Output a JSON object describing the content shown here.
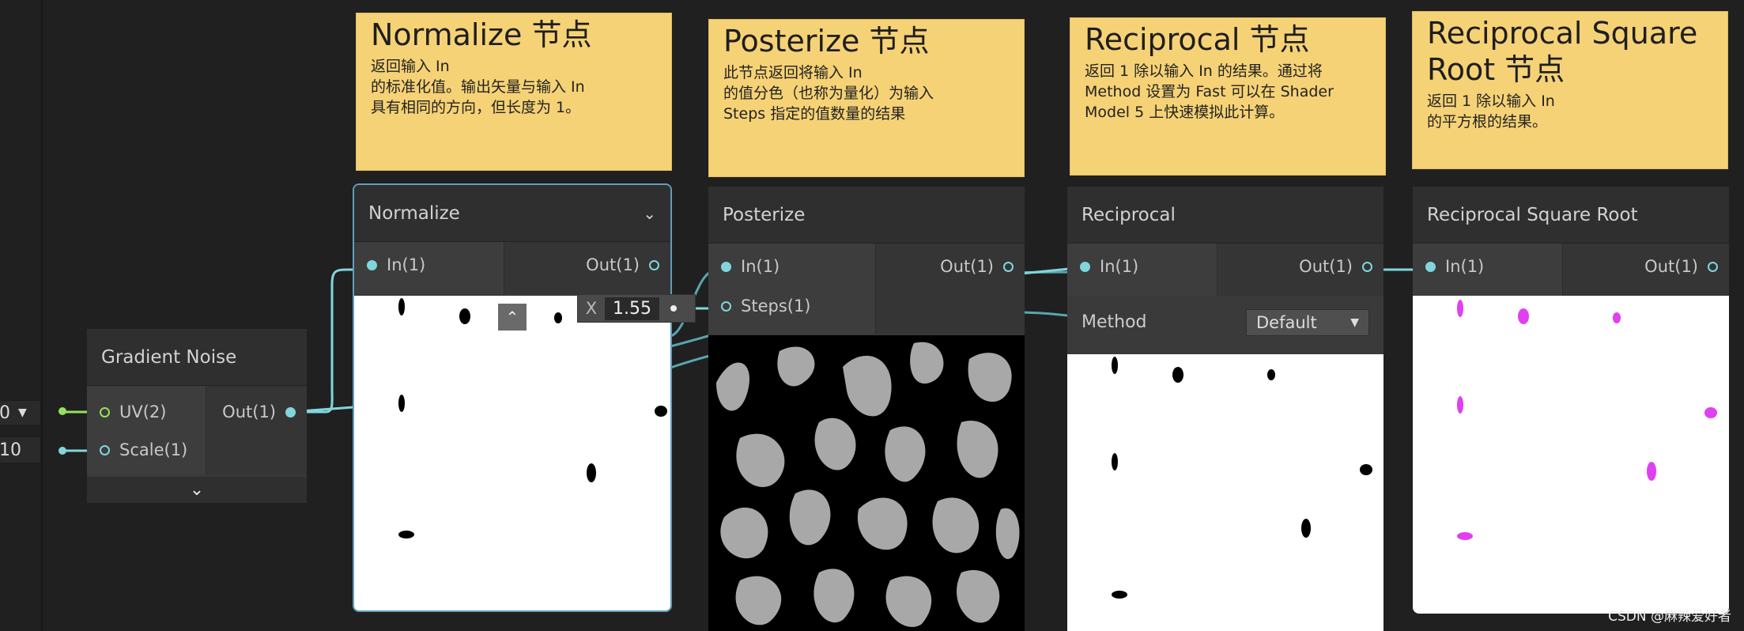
{
  "sticky_notes": [
    {
      "title": "Normalize 节点",
      "lines": [
        "返回输入 In",
        "的标准化值。输出矢量与输入 In",
        "具有相同的方向，但长度为 1。"
      ]
    },
    {
      "title": "Posterize 节点",
      "lines": [
        "此节点返回将输入 In",
        "的值分色（也称为量化）为输入",
        "Steps 指定的值数量的结果"
      ]
    },
    {
      "title": "Reciprocal 节点",
      "lines": [
        "返回 1 除以输入 In 的结果。通过将",
        "Method 设置为 Fast 可以在 Shader",
        "Model 5 上快速模拟此计算。"
      ]
    },
    {
      "title": "Reciprocal Square Root 节点",
      "lines": [
        "返回 1 除以输入 In",
        "的平方根的结果。"
      ]
    }
  ],
  "left_inputs": {
    "uv_value": "0",
    "scale_value": "10"
  },
  "gradient_noise": {
    "title": "Gradient Noise",
    "in_uv": "UV(2)",
    "in_scale": "Scale(1)",
    "out": "Out(1)"
  },
  "normalize": {
    "title": "Normalize",
    "in": "In(1)",
    "out": "Out(1)"
  },
  "posterize": {
    "title": "Posterize",
    "in": "In(1)",
    "steps": "Steps(1)",
    "out": "Out(1)",
    "steps_axis": "X",
    "steps_value": "1.55"
  },
  "reciprocal": {
    "title": "Reciprocal",
    "in": "In(1)",
    "out": "Out(1)",
    "method_label": "Method",
    "method_value": "Default"
  },
  "reciprocal_sqrt": {
    "title": "Reciprocal Square Root",
    "in": "In(1)",
    "out": "Out(1)"
  },
  "colors": {
    "port": "#80d6dc",
    "sticky": "#f6d276",
    "selection": "#5e9ec0",
    "magenta": "#e040f0"
  },
  "watermark": "CSDN @麻辣爱好者"
}
